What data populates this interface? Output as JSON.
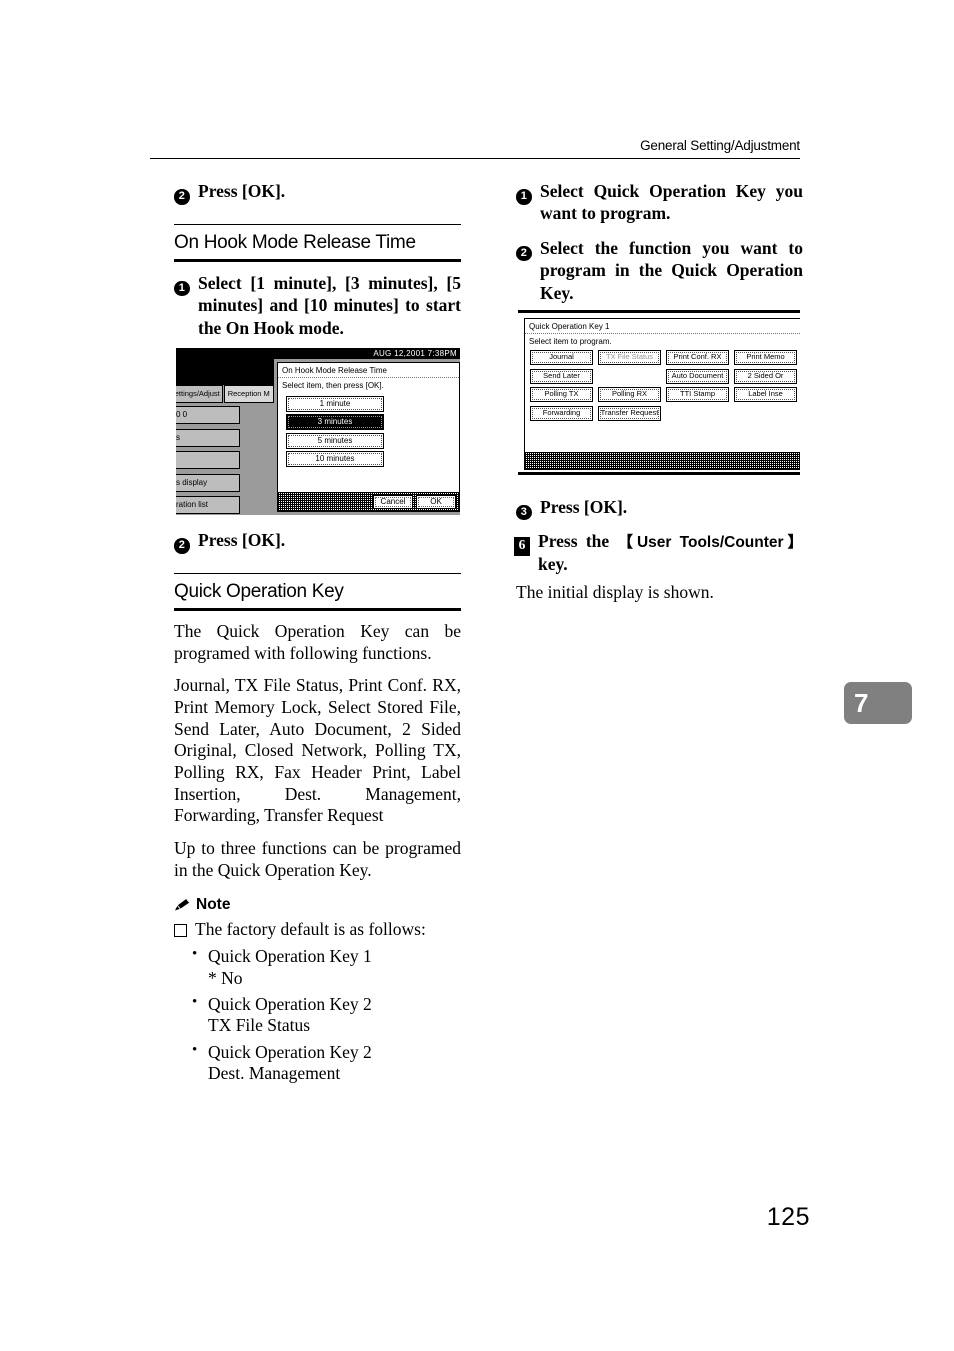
{
  "header": {
    "running_head": "General Setting/Adjustment"
  },
  "page_number": "125",
  "chapter_tab": "7",
  "left_column": {
    "step_top": {
      "num": "2",
      "text": "Press [OK]."
    },
    "section_onhook": {
      "title": "On Hook Mode Release Time",
      "step1": {
        "num": "1",
        "text": "Select [1 minute], [3 minutes], [5 minutes] and [10 minutes] to start the On Hook mode."
      },
      "step2": {
        "num": "2",
        "text": "Press [OK]."
      }
    },
    "section_quickkey": {
      "title": "Quick Operation Key",
      "para1": "The Quick Operation Key can be programed with following functions.",
      "para2": "Journal, TX File Status, Print Conf. RX, Print Memory Lock, Select Stored File, Send Later, Auto Document, 2 Sided Original, Closed Network, Polling TX, Polling RX, Fax Header Print, Label Insertion, Dest. Management, Forwarding, Transfer Request",
      "para3": "Up to three functions can be programed in the Quick Operation Key.",
      "note_label": "Note",
      "note_item": "The factory default is as follows:",
      "note_sublist": [
        {
          "line1": "Quick Operation Key 1",
          "line2": "* No"
        },
        {
          "line1": "Quick Operation Key 2",
          "line2": "TX File Status"
        },
        {
          "line1": "Quick Operation Key 2",
          "line2": "Dest. Management"
        }
      ]
    }
  },
  "right_column": {
    "step1": {
      "num": "1",
      "text": "Select Quick Operation Key you want to program."
    },
    "step2": {
      "num": "2",
      "text": "Select the function you want to program in the Quick Operation Key."
    },
    "step3": {
      "num": "3",
      "text": "Press [OK]."
    },
    "step6": {
      "num": "6",
      "text_a": "Press the ",
      "text_b": "【User Tools/Counter】",
      "text_c": " key."
    },
    "after_step6": "The initial display is shown."
  },
  "lcd_left": {
    "status_bar": "AUG 12,2001  7:38PM",
    "tabs": [
      "ettings/Adjust",
      "Reception M"
    ],
    "left_rows": [
      "0 0",
      "s",
      "",
      "s display",
      "ration list"
    ],
    "dialog": {
      "title": "On Hook Mode Release Time",
      "subtitle": "Select item, then press [OK].",
      "options": [
        {
          "label": "1 minute",
          "selected": false
        },
        {
          "label": "3 minutes",
          "selected": true
        },
        {
          "label": "5 minutes",
          "selected": false
        },
        {
          "label": "10 minutes",
          "selected": false
        }
      ],
      "cancel_label": "Cancel",
      "ok_label": "OK"
    }
  },
  "lcd_right": {
    "title": "Quick Operation Key  1",
    "subtitle": "Select item to program.",
    "rows": [
      [
        {
          "label": "Journal",
          "state": "normal"
        },
        {
          "label": "TX File Status",
          "state": "dim"
        },
        {
          "label": "Print Conf. RX",
          "state": "normal"
        },
        {
          "label": "Print Memo",
          "state": "normal"
        }
      ],
      [
        {
          "label": "Send Later",
          "state": "normal"
        },
        {
          "label": "",
          "state": "empty"
        },
        {
          "label": "Auto Document",
          "state": "normal"
        },
        {
          "label": "2 Sided Or",
          "state": "normal"
        }
      ],
      [
        {
          "label": "Polling TX",
          "state": "normal"
        },
        {
          "label": "Polling RX",
          "state": "normal"
        },
        {
          "label": "TTI Stamp",
          "state": "normal"
        },
        {
          "label": "Label Inse",
          "state": "normal"
        }
      ],
      [
        {
          "label": "Forwarding",
          "state": "normal"
        },
        {
          "label": "Transfer Request",
          "state": "normal"
        },
        {
          "label": "",
          "state": "empty"
        },
        {
          "label": "",
          "state": "empty"
        }
      ]
    ]
  }
}
